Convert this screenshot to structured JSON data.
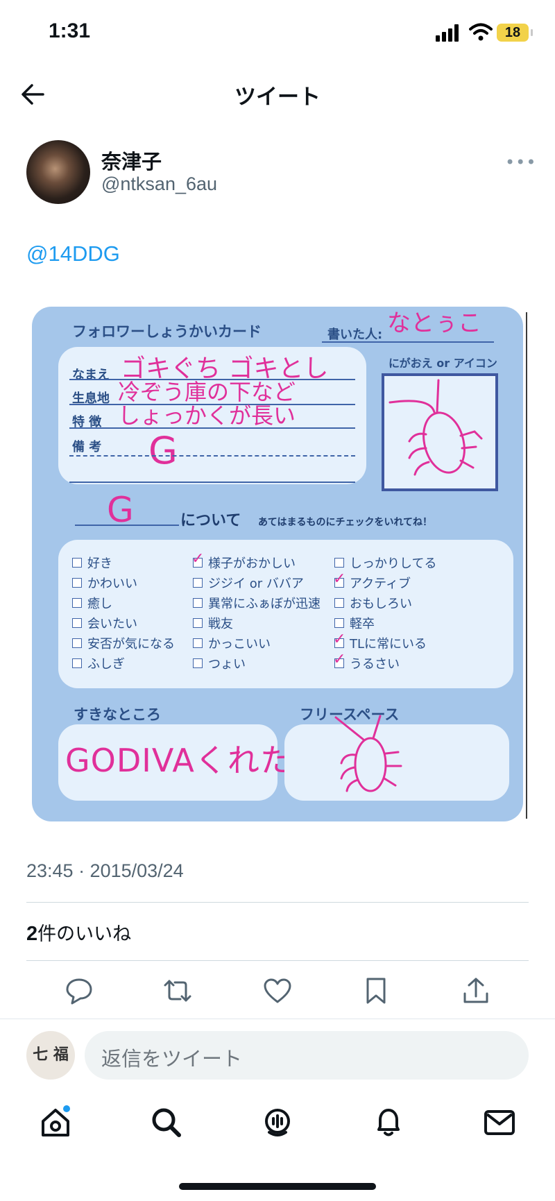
{
  "status_bar": {
    "time": "1:31",
    "battery": "18",
    "battery_color": "#f2d24a"
  },
  "header": {
    "title": "ツイート",
    "back_icon": "back-arrow-icon"
  },
  "tweet": {
    "author_name": "奈津子",
    "author_handle": "@ntksan_6au",
    "mention": "@14DDG",
    "timestamp": "23:45 · 2015/03/24",
    "likes_count": "2",
    "likes_label": "件のいいね"
  },
  "card": {
    "title": "フォロワーしょうかいカード",
    "writer_label": "書いた人:",
    "writer_value": "なとぅこ",
    "fields": [
      {
        "label": "なまえ",
        "value": "ゴキぐち ゴキとし"
      },
      {
        "label": "生息地",
        "value": "冷ぞう庫の下など"
      },
      {
        "label": "特 徴",
        "value": "しょっかくが長い"
      },
      {
        "label": "備 考",
        "value": "G"
      }
    ],
    "icon_label": "にがおえ or アイコン",
    "about_value": "G",
    "about_label": "について",
    "about_note": "あてはまるものにチェックをいれてね！",
    "checklist": [
      {
        "label": "好き",
        "checked": false
      },
      {
        "label": "かわいい",
        "checked": false
      },
      {
        "label": "癒し",
        "checked": false
      },
      {
        "label": "会いたい",
        "checked": false
      },
      {
        "label": "安否が気になる",
        "checked": false
      },
      {
        "label": "ふしぎ",
        "checked": false
      },
      {
        "label": "様子がおかしい",
        "checked": true
      },
      {
        "label": "ジジイ or ババア",
        "checked": false
      },
      {
        "label": "異常にふぁぼが迅速",
        "checked": false
      },
      {
        "label": "戦友",
        "checked": false
      },
      {
        "label": "かっこいい",
        "checked": false
      },
      {
        "label": "つょい",
        "checked": false
      },
      {
        "label": "しっかりしてる",
        "checked": false
      },
      {
        "label": "アクティブ",
        "checked": true
      },
      {
        "label": "おもしろい",
        "checked": false
      },
      {
        "label": "軽卒",
        "checked": false
      },
      {
        "label": "TLに常にいる",
        "checked": true
      },
      {
        "label": "うるさい",
        "checked": true
      }
    ],
    "likes_section": "すきなところ",
    "likes_value": "GODIVAくれた",
    "free_section": "フリースペース",
    "ink_color": "#e0309a",
    "card_color": "#a5c6ea"
  },
  "actions": [
    "reply-icon",
    "retweet-icon",
    "like-icon",
    "bookmark-icon",
    "share-icon"
  ],
  "compose": {
    "my_avatar_text": "七 福",
    "placeholder": "返信をツイート"
  },
  "bottom_nav": [
    "home-icon",
    "search-icon",
    "spaces-icon",
    "notifications-icon",
    "messages-icon"
  ],
  "accent_color": "#1d9bf0"
}
